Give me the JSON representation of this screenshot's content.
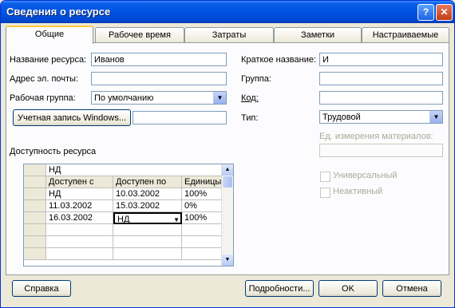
{
  "window": {
    "title": "Сведения о ресурсе",
    "help_glyph": "?",
    "close_glyph": "✕"
  },
  "tabs": [
    {
      "label": "Общие"
    },
    {
      "label": "Рабочее время"
    },
    {
      "label": "Затраты"
    },
    {
      "label": "Заметки"
    },
    {
      "label": "Настраиваемые поля"
    }
  ],
  "form": {
    "name_label": "Название ресурса:",
    "name_value": "Иванов",
    "email_label": "Адрес эл. почты:",
    "email_value": "",
    "workgroup_label": "Рабочая группа:",
    "workgroup_value": "По умолчанию",
    "windows_account_button": "Учетная запись Windows...",
    "windows_account_value": "",
    "short_name_label": "Краткое название:",
    "short_name_value": "И",
    "group_label": "Группа:",
    "group_value": "",
    "code_label": "Код:",
    "code_value": "",
    "type_label": "Тип:",
    "type_value": "Трудовой",
    "material_units_label": "Ед. измерения материалов:",
    "material_units_value": "",
    "generic_label": "Универсальный",
    "inactive_label": "Неактивный"
  },
  "availability": {
    "section_label": "Доступность ресурса",
    "edit_value": "НД",
    "columns": [
      "Доступен с",
      "Доступен по",
      "Единицы"
    ],
    "rows": [
      [
        "НД",
        "10.03.2002",
        "100%"
      ],
      [
        "11.03.2002",
        "15.03.2002",
        "0%"
      ],
      [
        "16.03.2002",
        "НД",
        "100%"
      ]
    ]
  },
  "footer": {
    "help_button": "Справка",
    "details_button": "Подробности...",
    "ok_button": "OK",
    "cancel_button": "Отмена"
  }
}
